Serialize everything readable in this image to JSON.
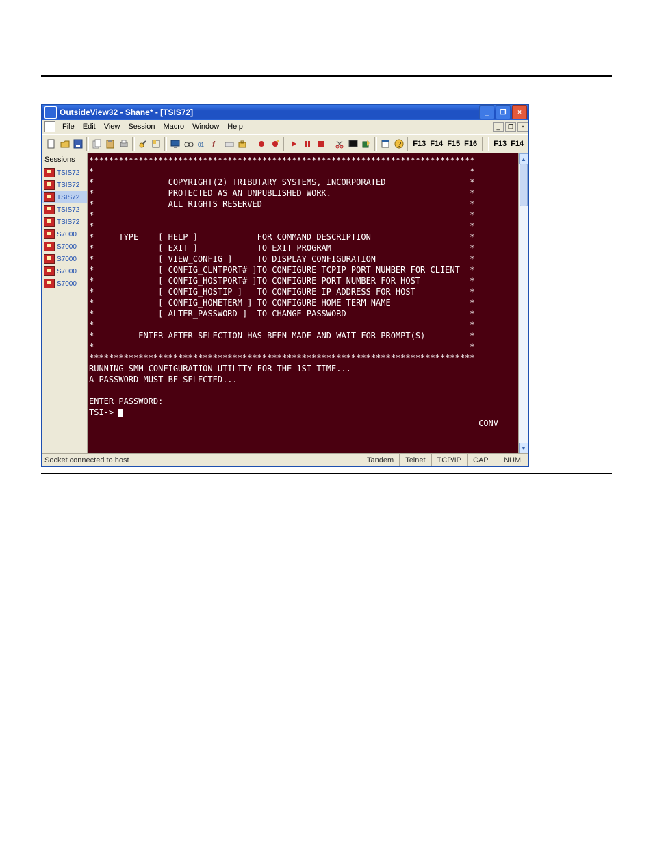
{
  "window": {
    "title": "OutsideView32 - Shane* - [TSIS72]"
  },
  "menu": {
    "items": [
      "File",
      "Edit",
      "View",
      "Session",
      "Macro",
      "Window",
      "Help"
    ],
    "mdi": {
      "min": "_",
      "restore": "❐",
      "close": "×"
    }
  },
  "titlebar": {
    "min": "_",
    "max": "❐",
    "close": "×"
  },
  "toolbar": {
    "fkeys_left": [
      "F13",
      "F14",
      "F15",
      "F16"
    ],
    "fkeys_right": [
      "F13",
      "F14"
    ]
  },
  "sidebar": {
    "header": "Sessions",
    "items": [
      {
        "label": "TSIS72",
        "selected": false
      },
      {
        "label": "TSIS72",
        "selected": false
      },
      {
        "label": "TSIS72",
        "selected": true
      },
      {
        "label": "TSIS72",
        "selected": false
      },
      {
        "label": "TSIS72",
        "selected": false
      },
      {
        "label": "S7000",
        "selected": false
      },
      {
        "label": "S7000",
        "selected": false
      },
      {
        "label": "S7000",
        "selected": false
      },
      {
        "label": "S7000",
        "selected": false
      },
      {
        "label": "S7000",
        "selected": false
      }
    ]
  },
  "terminal": {
    "lines": [
      "******************************************************************************",
      "*                                                                            *",
      "*               COPYRIGHT(2) TRIBUTARY SYSTEMS, INCORPORATED                 *",
      "*               PROTECTED AS AN UNPUBLISHED WORK.                            *",
      "*               ALL RIGHTS RESERVED                                          *",
      "*                                                                            *",
      "*                                                                            *",
      "*     TYPE    [ HELP ]            FOR COMMAND DESCRIPTION                    *",
      "*             [ EXIT ]            TO EXIT PROGRAM                            *",
      "*             [ VIEW_CONFIG ]     TO DISPLAY CONFIGURATION                   *",
      "*             [ CONFIG_CLNTPORT# ]TO CONFIGURE TCPIP PORT NUMBER FOR CLIENT  *",
      "*             [ CONFIG_HOSTPORT# ]TO CONFIGURE PORT NUMBER FOR HOST          *",
      "*             [ CONFIG_HOSTIP ]   TO CONFIGURE IP ADDRESS FOR HOST           *",
      "*             [ CONFIG_HOMETERM ] TO CONFIGURE HOME TERM NAME                *",
      "*             [ ALTER_PASSWORD ]  TO CHANGE PASSWORD                         *",
      "*                                                                            *",
      "*         ENTER AFTER SELECTION HAS BEEN MADE AND WAIT FOR PROMPT(S)         *",
      "*                                                                            *",
      "******************************************************************************",
      "RUNNING SMM CONFIGURATION UTILITY FOR THE 1ST TIME...",
      "A PASSWORD MUST BE SELECTED...",
      "",
      "ENTER PASSWORD:"
    ],
    "prompt": "TSI-> ",
    "mode": "CONV"
  },
  "status": {
    "message": "Socket connected to host",
    "cells": [
      "Tandem",
      "Telnet",
      "TCP/IP",
      "CAP",
      "NUM"
    ]
  }
}
